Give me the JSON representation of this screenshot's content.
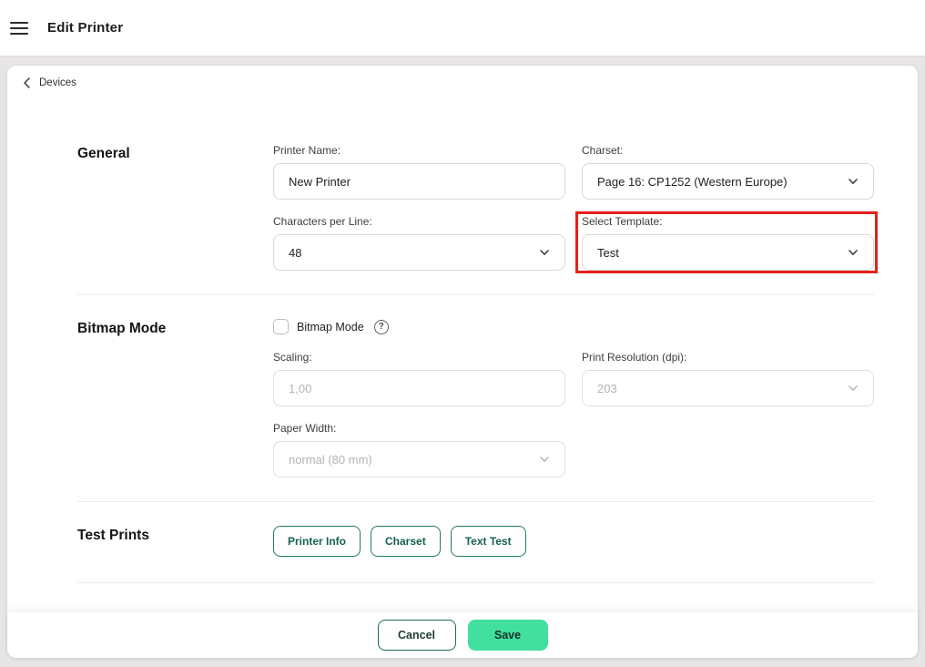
{
  "header": {
    "title": "Edit Printer"
  },
  "back": {
    "label": "Devices"
  },
  "sections": {
    "general": {
      "title": "General",
      "fields": {
        "printer_name": {
          "label": "Printer Name:",
          "value": "New Printer"
        },
        "charset": {
          "label": "Charset:",
          "value": "Page 16: CP1252 (Western Europe)"
        },
        "chars_per_line": {
          "label": "Characters per Line:",
          "value": "48"
        },
        "select_template": {
          "label": "Select Template:",
          "value": "Test",
          "highlighted": true
        }
      }
    },
    "bitmap": {
      "title": "Bitmap Mode",
      "checkbox_label": "Bitmap Mode",
      "checkbox_checked": false,
      "help_glyph": "?",
      "fields": {
        "scaling": {
          "label": "Scaling:",
          "value": "1,00",
          "disabled": true
        },
        "print_resolution": {
          "label": "Print Resolution (dpi):",
          "value": "203",
          "disabled": true
        },
        "paper_width": {
          "label": "Paper Width:",
          "value": "normal (80 mm)",
          "disabled": true
        }
      }
    },
    "test_prints": {
      "title": "Test Prints",
      "buttons": [
        "Printer Info",
        "Charset",
        "Text Test"
      ]
    }
  },
  "footer": {
    "cancel_label": "Cancel",
    "save_label": "Save"
  },
  "colors": {
    "accent_teal": "#1b7b64",
    "save_green": "#41e09e",
    "highlight_red": "#e32119",
    "page_background": "#e7e5e5"
  }
}
